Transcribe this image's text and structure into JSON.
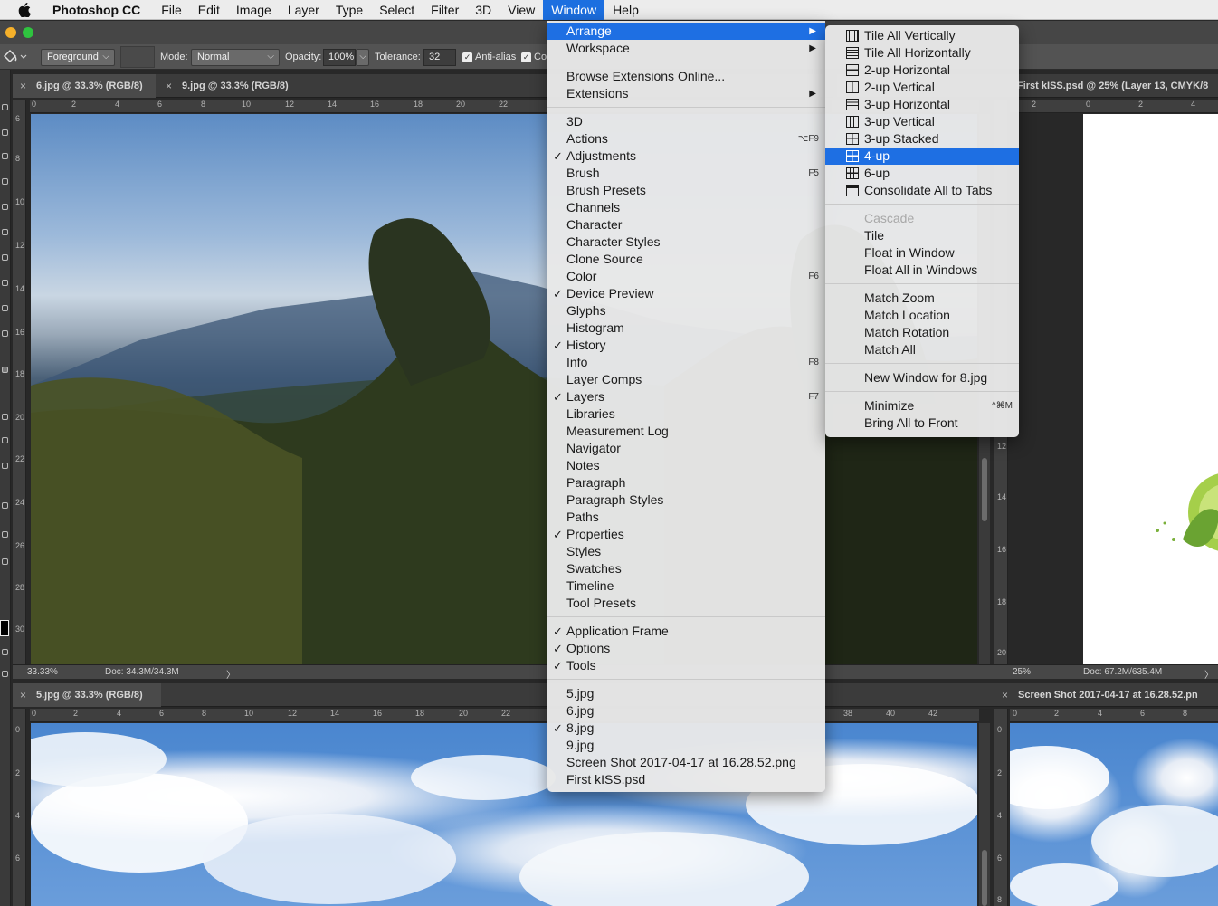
{
  "menubar": {
    "app": "Photoshop CC",
    "items": [
      "File",
      "Edit",
      "Image",
      "Layer",
      "Type",
      "Select",
      "Filter",
      "3D",
      "View",
      "Window",
      "Help"
    ],
    "active": "Window"
  },
  "options_bar": {
    "preset": "Foreground",
    "mode_label": "Mode:",
    "mode_value": "Normal",
    "opacity_label": "Opacity:",
    "opacity_value": "100%",
    "tolerance_label": "Tolerance:",
    "tolerance_value": "32",
    "antialias_label": "Anti-alias",
    "contiguous_label": "Co"
  },
  "panes": {
    "top_left": {
      "tab1": "6.jpg @ 33.3% (RGB/8)",
      "tab2": "9.jpg @ 33.3% (RGB/8)",
      "zoom": "33.33%",
      "doc": "Doc: 34.3M/34.3M"
    },
    "top_right": {
      "tab": "First kISS.psd @ 25% (Layer 13, CMYK/8",
      "zoom": "25%",
      "doc": "Doc: 67.2M/635.4M"
    },
    "bottom_left": {
      "tab": "5.jpg @ 33.3% (RGB/8)"
    },
    "bottom_right": {
      "tab": "Screen Shot 2017-04-17 at 16.28.52.pn"
    }
  },
  "rulers": {
    "top_left_h": [
      "0",
      "2",
      "4",
      "6",
      "8",
      "10",
      "12",
      "14",
      "16",
      "18",
      "20",
      "22"
    ],
    "top_left_v": [
      "6",
      "8",
      "10",
      "12",
      "14",
      "16",
      "18",
      "20",
      "22",
      "24",
      "26",
      "28",
      "30"
    ],
    "top_right_h": [
      "2",
      "0",
      "2",
      "4"
    ],
    "top_right_v": [
      "12",
      "14",
      "16",
      "18",
      "20"
    ],
    "bottom_left_h": [
      "0",
      "2",
      "4",
      "6",
      "8",
      "10",
      "12",
      "14",
      "16",
      "18",
      "20",
      "22",
      "38",
      "40",
      "42"
    ],
    "bottom_left_v": [
      "0",
      "2",
      "4",
      "6"
    ],
    "bottom_right_h": [
      "0",
      "2",
      "4",
      "6",
      "8"
    ],
    "bottom_right_v": [
      "0",
      "2",
      "4",
      "6",
      "8"
    ]
  },
  "window_menu": {
    "groups": [
      [
        {
          "label": "Arrange",
          "submenu": true,
          "highlighted": true
        },
        {
          "label": "Workspace",
          "submenu": true
        }
      ],
      [
        {
          "label": "Browse Extensions Online..."
        },
        {
          "label": "Extensions",
          "submenu": true
        }
      ],
      [
        {
          "label": "3D"
        },
        {
          "label": "Actions",
          "shortcut": "⌥F9"
        },
        {
          "label": "Adjustments",
          "checked": true
        },
        {
          "label": "Brush",
          "shortcut": "F5"
        },
        {
          "label": "Brush Presets"
        },
        {
          "label": "Channels"
        },
        {
          "label": "Character"
        },
        {
          "label": "Character Styles"
        },
        {
          "label": "Clone Source"
        },
        {
          "label": "Color",
          "shortcut": "F6"
        },
        {
          "label": "Device Preview",
          "checked": true
        },
        {
          "label": "Glyphs"
        },
        {
          "label": "Histogram"
        },
        {
          "label": "History",
          "checked": true
        },
        {
          "label": "Info",
          "shortcut": "F8"
        },
        {
          "label": "Layer Comps"
        },
        {
          "label": "Layers",
          "checked": true,
          "shortcut": "F7"
        },
        {
          "label": "Libraries"
        },
        {
          "label": "Measurement Log"
        },
        {
          "label": "Navigator"
        },
        {
          "label": "Notes"
        },
        {
          "label": "Paragraph"
        },
        {
          "label": "Paragraph Styles"
        },
        {
          "label": "Paths"
        },
        {
          "label": "Properties",
          "checked": true
        },
        {
          "label": "Styles"
        },
        {
          "label": "Swatches"
        },
        {
          "label": "Timeline"
        },
        {
          "label": "Tool Presets"
        }
      ],
      [
        {
          "label": "Application Frame",
          "checked": true
        },
        {
          "label": "Options",
          "checked": true
        },
        {
          "label": "Tools",
          "checked": true
        }
      ],
      [
        {
          "label": "5.jpg"
        },
        {
          "label": "6.jpg"
        },
        {
          "label": "8.jpg",
          "checked": true
        },
        {
          "label": "9.jpg"
        },
        {
          "label": "Screen Shot 2017-04-17 at 16.28.52.png"
        },
        {
          "label": "First kISS.psd"
        }
      ]
    ]
  },
  "arrange_submenu": {
    "groups": [
      [
        {
          "label": "Tile All Vertically",
          "icon": "tile-vertical-icon"
        },
        {
          "label": "Tile All Horizontally",
          "icon": "tile-horizontal-icon"
        },
        {
          "label": "2-up Horizontal",
          "icon": "two-up-horizontal-icon"
        },
        {
          "label": "2-up Vertical",
          "icon": "two-up-vertical-icon"
        },
        {
          "label": "3-up Horizontal",
          "icon": "three-up-horizontal-icon"
        },
        {
          "label": "3-up Vertical",
          "icon": "three-up-vertical-icon"
        },
        {
          "label": "3-up Stacked",
          "icon": "three-up-stacked-icon"
        },
        {
          "label": "4-up",
          "icon": "four-up-icon",
          "highlighted": true
        },
        {
          "label": "6-up",
          "icon": "six-up-icon"
        },
        {
          "label": "Consolidate All to Tabs",
          "icon": "consolidate-tabs-icon"
        }
      ],
      [
        {
          "label": "Cascade",
          "disabled": true
        },
        {
          "label": "Tile"
        },
        {
          "label": "Float in Window"
        },
        {
          "label": "Float All in Windows"
        }
      ],
      [
        {
          "label": "Match Zoom"
        },
        {
          "label": "Match Location"
        },
        {
          "label": "Match Rotation"
        },
        {
          "label": "Match All"
        }
      ],
      [
        {
          "label": "New Window for 8.jpg"
        }
      ],
      [
        {
          "label": "Minimize",
          "shortcut": "^⌘M"
        },
        {
          "label": "Bring All to Front"
        }
      ]
    ]
  },
  "colors": {
    "menu_highlight": "#1e6fe3",
    "panel_bg": "#535353",
    "canvas_bg": "#282828"
  }
}
